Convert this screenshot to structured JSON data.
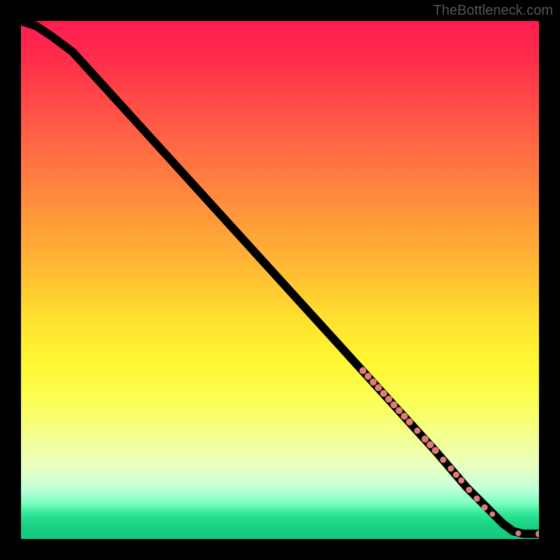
{
  "watermark": "TheBottleneck.com",
  "chart_data": {
    "type": "line",
    "title": "",
    "xlabel": "",
    "ylabel": "",
    "xlim": [
      0,
      100
    ],
    "ylim": [
      0,
      100
    ],
    "series": [
      {
        "name": "curve",
        "x": [
          0,
          3,
          6,
          10,
          20,
          30,
          40,
          50,
          60,
          70,
          80,
          86,
          90,
          93,
          95,
          97,
          100
        ],
        "y": [
          100,
          99,
          97,
          94,
          83,
          72,
          61,
          50,
          39,
          28,
          17,
          10,
          6,
          3,
          1.5,
          1,
          1
        ]
      }
    ],
    "markers": {
      "name": "highlighted-points",
      "color": "#e07a75",
      "x": [
        66,
        67,
        68,
        69,
        70,
        71,
        72,
        73,
        74,
        75,
        76.5,
        78,
        79,
        80,
        81.5,
        83,
        84,
        85,
        86.5,
        88,
        89.5,
        91,
        96,
        100
      ],
      "y": [
        32.5,
        31.4,
        30.3,
        29.2,
        28.1,
        27.0,
        25.9,
        24.8,
        23.7,
        22.6,
        20.9,
        19.3,
        18.2,
        17.1,
        15.3,
        13.6,
        12.4,
        11.3,
        9.5,
        7.8,
        6.1,
        4.8,
        1.1,
        1.0
      ],
      "r": [
        5,
        5,
        5,
        5,
        5,
        5,
        5,
        5,
        5,
        5,
        4.5,
        5,
        5,
        5,
        4.5,
        4.5,
        4.5,
        4.5,
        4.5,
        4.5,
        4.5,
        4,
        4,
        5
      ]
    }
  }
}
